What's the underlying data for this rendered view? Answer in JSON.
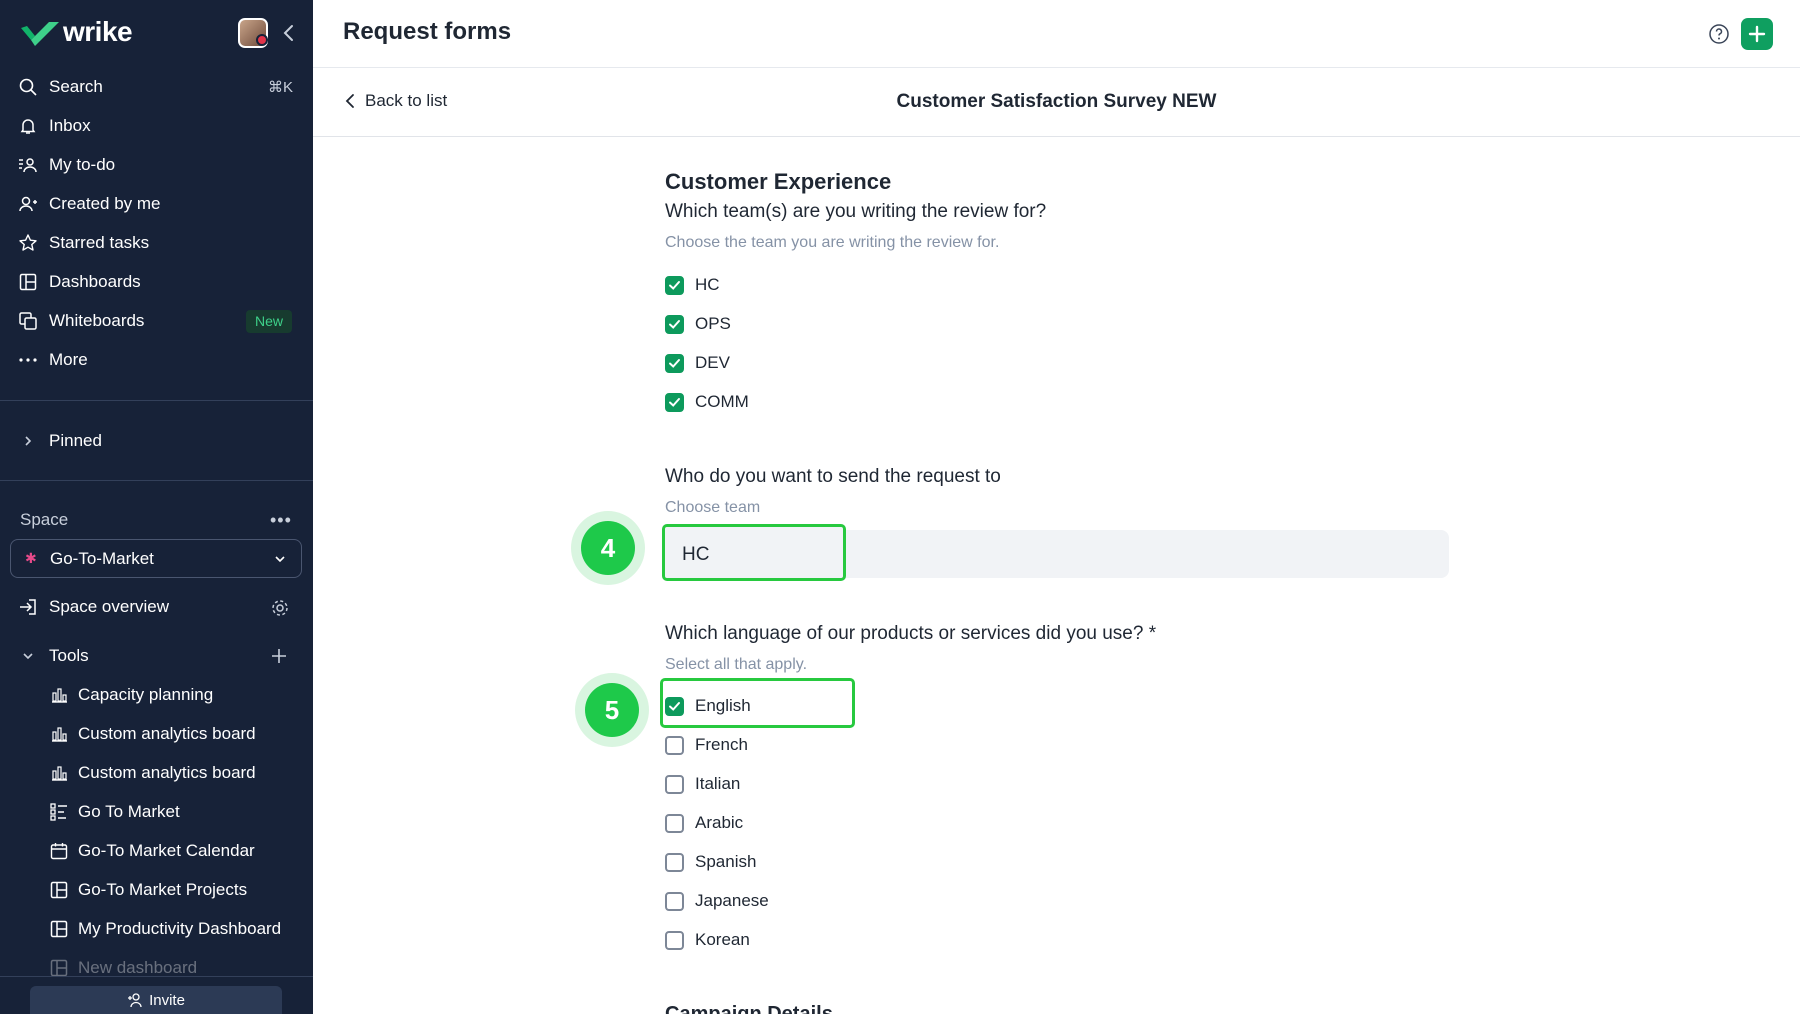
{
  "sidebar": {
    "brand": "wrike",
    "nav": [
      {
        "label": "Search",
        "icon": "search-icon",
        "shortcut": "⌘K"
      },
      {
        "label": "Inbox",
        "icon": "bell-icon"
      },
      {
        "label": "My to-do",
        "icon": "todo-icon"
      },
      {
        "label": "Created by me",
        "icon": "user-created-icon"
      },
      {
        "label": "Starred tasks",
        "icon": "star-icon"
      },
      {
        "label": "Dashboards",
        "icon": "dashboard-icon"
      },
      {
        "label": "Whiteboards",
        "icon": "whiteboard-icon",
        "badge": "New"
      },
      {
        "label": "More",
        "icon": "more-icon"
      }
    ],
    "pinned": "Pinned",
    "space_label": "Space",
    "space_selected": "Go-To-Market",
    "space_overview": "Space overview",
    "tools_label": "Tools",
    "tools": [
      {
        "label": "Capacity planning",
        "icon": "analytics-icon"
      },
      {
        "label": "Custom analytics board",
        "icon": "analytics-icon"
      },
      {
        "label": "Custom analytics board",
        "icon": "analytics-icon"
      },
      {
        "label": "Go To Market",
        "icon": "workflow-icon"
      },
      {
        "label": "Go-To Market Calendar",
        "icon": "calendar-icon"
      },
      {
        "label": "Go-To Market Projects",
        "icon": "dashboard-icon"
      },
      {
        "label": "My Productivity Dashboard",
        "icon": "dashboard-icon"
      },
      {
        "label": "New dashboard",
        "icon": "dashboard-icon"
      }
    ],
    "invite": "Invite"
  },
  "header": {
    "title": "Request forms"
  },
  "subheader": {
    "back": "Back to list",
    "form_title": "Customer Satisfaction Survey NEW"
  },
  "form": {
    "section_title": "Customer Experience",
    "q1": {
      "label": "Which team(s) are you writing the review for?",
      "hint": "Choose the team you are writing the review for.",
      "options": [
        {
          "label": "HC",
          "checked": true
        },
        {
          "label": "OPS",
          "checked": true
        },
        {
          "label": "DEV",
          "checked": true
        },
        {
          "label": "COMM",
          "checked": true
        }
      ]
    },
    "q2": {
      "label": "Who do you want to send the request to",
      "hint": "Choose team",
      "value": "HC"
    },
    "q3": {
      "label": "Which language of our products or services did you use? *",
      "hint": "Select all that apply.",
      "options": [
        {
          "label": "English",
          "checked": true
        },
        {
          "label": "French",
          "checked": false
        },
        {
          "label": "Italian",
          "checked": false
        },
        {
          "label": "Arabic",
          "checked": false
        },
        {
          "label": "Spanish",
          "checked": false
        },
        {
          "label": "Japanese",
          "checked": false
        },
        {
          "label": "Korean",
          "checked": false
        }
      ]
    },
    "next_section": "Campaign Details"
  },
  "steps": [
    "4",
    "5"
  ],
  "colors": {
    "sidebar_bg": "#172238",
    "accent_green": "#0d9a5c",
    "highlight_green": "#27c93f"
  }
}
